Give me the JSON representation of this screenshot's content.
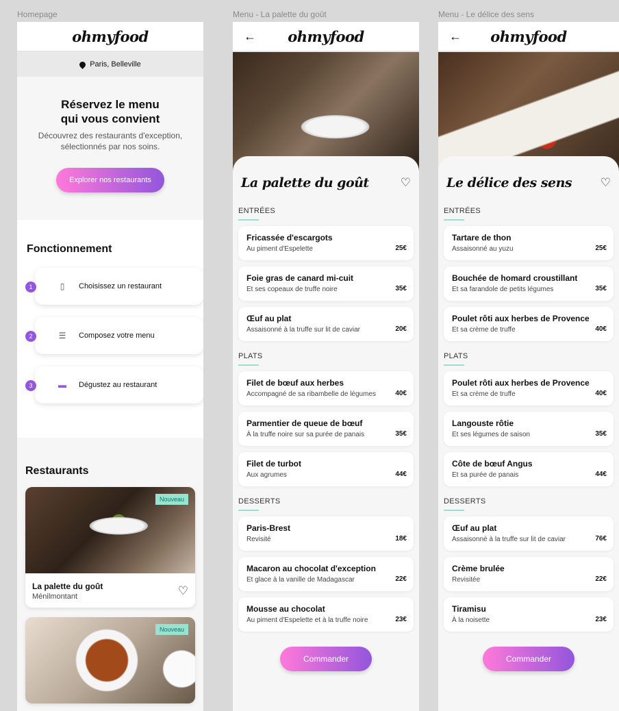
{
  "labels": [
    "Homepage",
    "Menu - La palette du goût",
    "Menu - Le délice des sens"
  ],
  "brand": "ohmyfood",
  "home": {
    "location": "Paris, Belleville",
    "hero_title": "Réservez le menu qui vous convient",
    "hero_text": "Découvrez des restaurants d'exception, sélectionnés par nos soins.",
    "cta": "Explorer nos restaurants",
    "how_title": "Fonctionnement",
    "steps": [
      {
        "num": "1",
        "icon": "phone-icon",
        "label": "Choisissez un restaurant"
      },
      {
        "num": "2",
        "icon": "list-icon",
        "label": "Composez votre menu"
      },
      {
        "num": "3",
        "icon": "plate-icon",
        "label": "Dégustez au restaurant"
      }
    ],
    "rest_title": "Restaurants",
    "cards": [
      {
        "badge": "Nouveau",
        "name": "La palette du goût",
        "place": "Ménilmontant"
      },
      {
        "badge": "Nouveau",
        "name": "",
        "place": ""
      }
    ]
  },
  "menu1": {
    "title": "La palette du goût",
    "entrees_label": "ENTRÉES",
    "plats_label": "PLATS",
    "desserts_label": "DESSERTS",
    "entrees": [
      {
        "name": "Fricassée d'escargots",
        "desc": "Au piment d'Espelette",
        "price": "25€"
      },
      {
        "name": "Foie gras de canard mi-cuit",
        "desc": "Et ses copeaux de truffe noire",
        "price": "35€"
      },
      {
        "name": "Œuf au plat",
        "desc": "Assaisonné à la truffe sur lit de caviar",
        "price": "20€"
      }
    ],
    "plats": [
      {
        "name": "Filet de bœuf aux herbes",
        "desc": "Accompagné de sa ribambelle de légumes",
        "price": "40€"
      },
      {
        "name": "Parmentier de queue de bœuf",
        "desc": "À la truffe noire sur sa purée de panais",
        "price": "35€"
      },
      {
        "name": "Filet de turbot",
        "desc": "Aux agrumes",
        "price": "44€"
      }
    ],
    "desserts": [
      {
        "name": "Paris-Brest",
        "desc": "Revisité",
        "price": "18€"
      },
      {
        "name": "Macaron au chocolat d'exception",
        "desc": "Et glace à la vanille de Madagascar",
        "price": "22€"
      },
      {
        "name": "Mousse au chocolat",
        "desc": "Au piment d'Espelette et à la truffe noire",
        "price": "23€"
      }
    ],
    "order": "Commander"
  },
  "menu2": {
    "title": "Le délice des sens",
    "entrees_label": "ENTRÉES",
    "plats_label": "PLATS",
    "desserts_label": "DESSERTS",
    "entrees": [
      {
        "name": "Tartare de thon",
        "desc": "Assaisonné au yuzu",
        "price": "25€"
      },
      {
        "name": "Bouchée de homard croustillant",
        "desc": "Et sa farandole de petits légumes",
        "price": "35€"
      },
      {
        "name": "Poulet rôti aux herbes de Provence",
        "desc": "Et sa crème de truffe",
        "price": "40€"
      }
    ],
    "plats": [
      {
        "name": "Poulet rôti aux herbes de Provence",
        "desc": "Et sa crème de truffe",
        "price": "40€"
      },
      {
        "name": "Langouste rôtie",
        "desc": "Et ses légumes de saison",
        "price": "35€"
      },
      {
        "name": "Côte de bœuf Angus",
        "desc": "Et sa purée de panais",
        "price": "44€"
      }
    ],
    "desserts": [
      {
        "name": "Œuf au plat",
        "desc": "Assaisonné à la truffe sur lit de caviar",
        "price": "76€"
      },
      {
        "name": "Crème brulée",
        "desc": "Revisitée",
        "price": "22€"
      },
      {
        "name": "Tiramisu",
        "desc": "À la noisette",
        "price": "23€"
      }
    ],
    "order": "Commander"
  },
  "colors": {
    "accent_start": "#ff79da",
    "accent_end": "#9356dc",
    "badge": "#99e2d0"
  }
}
